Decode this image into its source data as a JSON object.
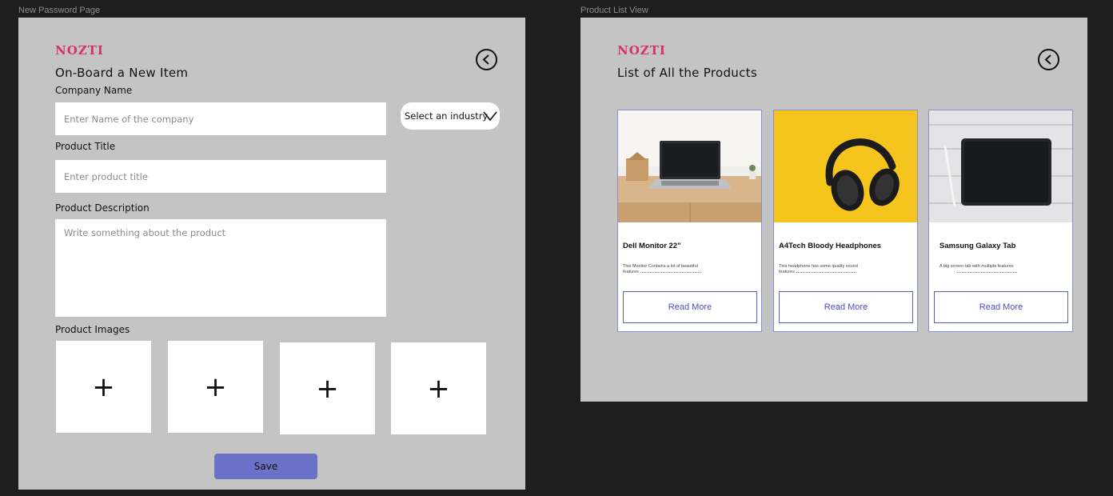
{
  "frames": {
    "left_label": "New Password Page",
    "right_label": "Product List View"
  },
  "form": {
    "logo": "NOZTI",
    "title": "On-Board a New Item",
    "company_label": "Company Name",
    "company_placeholder": "Enter Name of the company",
    "industry_select": "Select an industry",
    "product_title_label": "Product Title",
    "product_title_placeholder": "Enter product title",
    "description_label": "Product Description",
    "description_placeholder": "Write something about the product",
    "images_label": "Product Images",
    "image_slots": [
      "+",
      "+",
      "+",
      "+"
    ],
    "save_label": "Save"
  },
  "list": {
    "logo": "NOZTI",
    "title": "List of All the Products",
    "products": [
      {
        "name": "Dell Monitor 22\"",
        "description": "This Monitor Contains a lot of beautiful features",
        "button": "Read More",
        "image": "laptop-on-desk"
      },
      {
        "name": "A4Tech Bloody Headphones",
        "description": "This headphone has some quality sound features",
        "button": "Read More",
        "image": "headphones-on-yellow"
      },
      {
        "name": "Samsung Galaxy Tab",
        "description": "A big screen tab with multiple features",
        "button": "Read More",
        "image": "tablet-on-white-desk"
      }
    ]
  },
  "colors": {
    "canvas": "#1e1e1e",
    "frame": "#c4c4c4",
    "brand": "#d7306b",
    "accent": "#6b72c8",
    "link": "#4a50c0"
  }
}
